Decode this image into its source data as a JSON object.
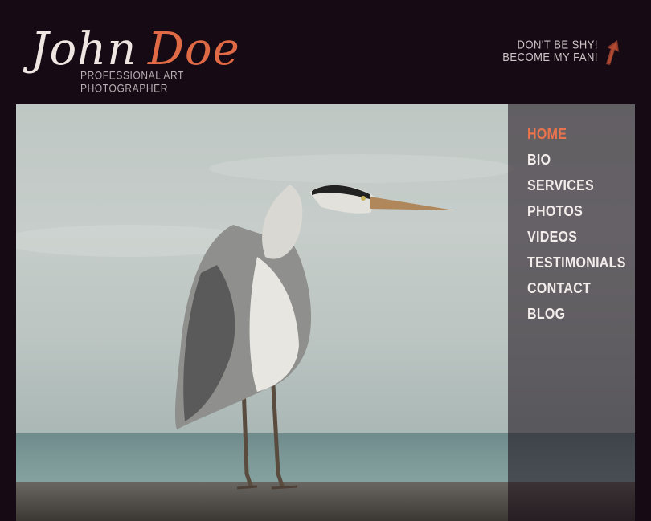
{
  "brand": {
    "first_name": "John",
    "last_name": "Doe",
    "tagline": "PROFESSIONAL ART PHOTOGRAPHER"
  },
  "fan_link": {
    "line1": "DON'T BE SHY!",
    "line2": "BECOME MY FAN!"
  },
  "nav": {
    "items": [
      {
        "label": "HOME",
        "active": true
      },
      {
        "label": "BIO"
      },
      {
        "label": "SERVICES"
      },
      {
        "label": "PHOTOS"
      },
      {
        "label": "VIDEOS"
      },
      {
        "label": "TESTIMONIALS"
      },
      {
        "label": "CONTACT"
      },
      {
        "label": "BLOG"
      }
    ]
  },
  "colors": {
    "background": "#160b14",
    "accent": "#e06a45",
    "menu_text": "#f2eceb"
  },
  "icons": {
    "fan_arrow": "arrow-up-right-icon"
  }
}
